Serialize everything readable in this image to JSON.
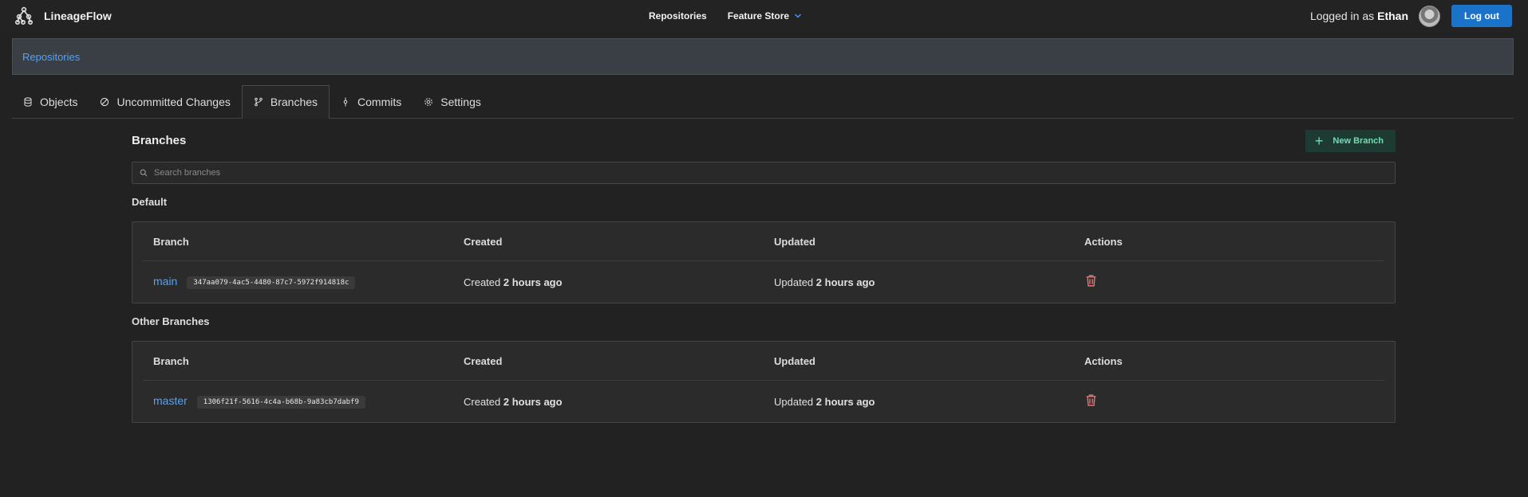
{
  "app": {
    "name": "LineageFlow"
  },
  "topnav": {
    "repositories": "Repositories",
    "feature_store": "Feature Store"
  },
  "user": {
    "logged_in_label": "Logged in as",
    "name": "Ethan",
    "logout_label": "Log out"
  },
  "breadcrumb": {
    "root": "Repositories"
  },
  "tabs": [
    {
      "label": "Objects",
      "icon": "database-icon"
    },
    {
      "label": "Uncommitted Changes",
      "icon": "circle-slash-icon"
    },
    {
      "label": "Branches",
      "icon": "git-branch-icon",
      "active": true
    },
    {
      "label": "Commits",
      "icon": "git-commit-icon"
    },
    {
      "label": "Settings",
      "icon": "gear-icon"
    }
  ],
  "page": {
    "title": "Branches",
    "new_branch_label": "New Branch",
    "search_placeholder": "Search branches"
  },
  "columns": {
    "branch": "Branch",
    "created": "Created",
    "updated": "Updated",
    "actions": "Actions"
  },
  "sections": {
    "default": {
      "label": "Default",
      "rows": [
        {
          "name": "main",
          "hash": "347aa079-4ac5-4480-87c7-5972f914818c",
          "created_prefix": "Created",
          "created_value": "2 hours ago",
          "updated_prefix": "Updated",
          "updated_value": "2 hours ago"
        }
      ]
    },
    "other": {
      "label": "Other Branches",
      "rows": [
        {
          "name": "master",
          "hash": "1306f21f-5616-4c4a-b68b-9a83cb7dabf9",
          "created_prefix": "Created",
          "created_value": "2 hours ago",
          "updated_prefix": "Updated",
          "updated_value": "2 hours ago"
        }
      ]
    }
  },
  "colors": {
    "accent": "#4da3ff",
    "logout": "#1a73c8",
    "new_branch_bg": "#1e3b33",
    "new_branch_text": "#6fdcb0",
    "trash": "#e57373"
  }
}
